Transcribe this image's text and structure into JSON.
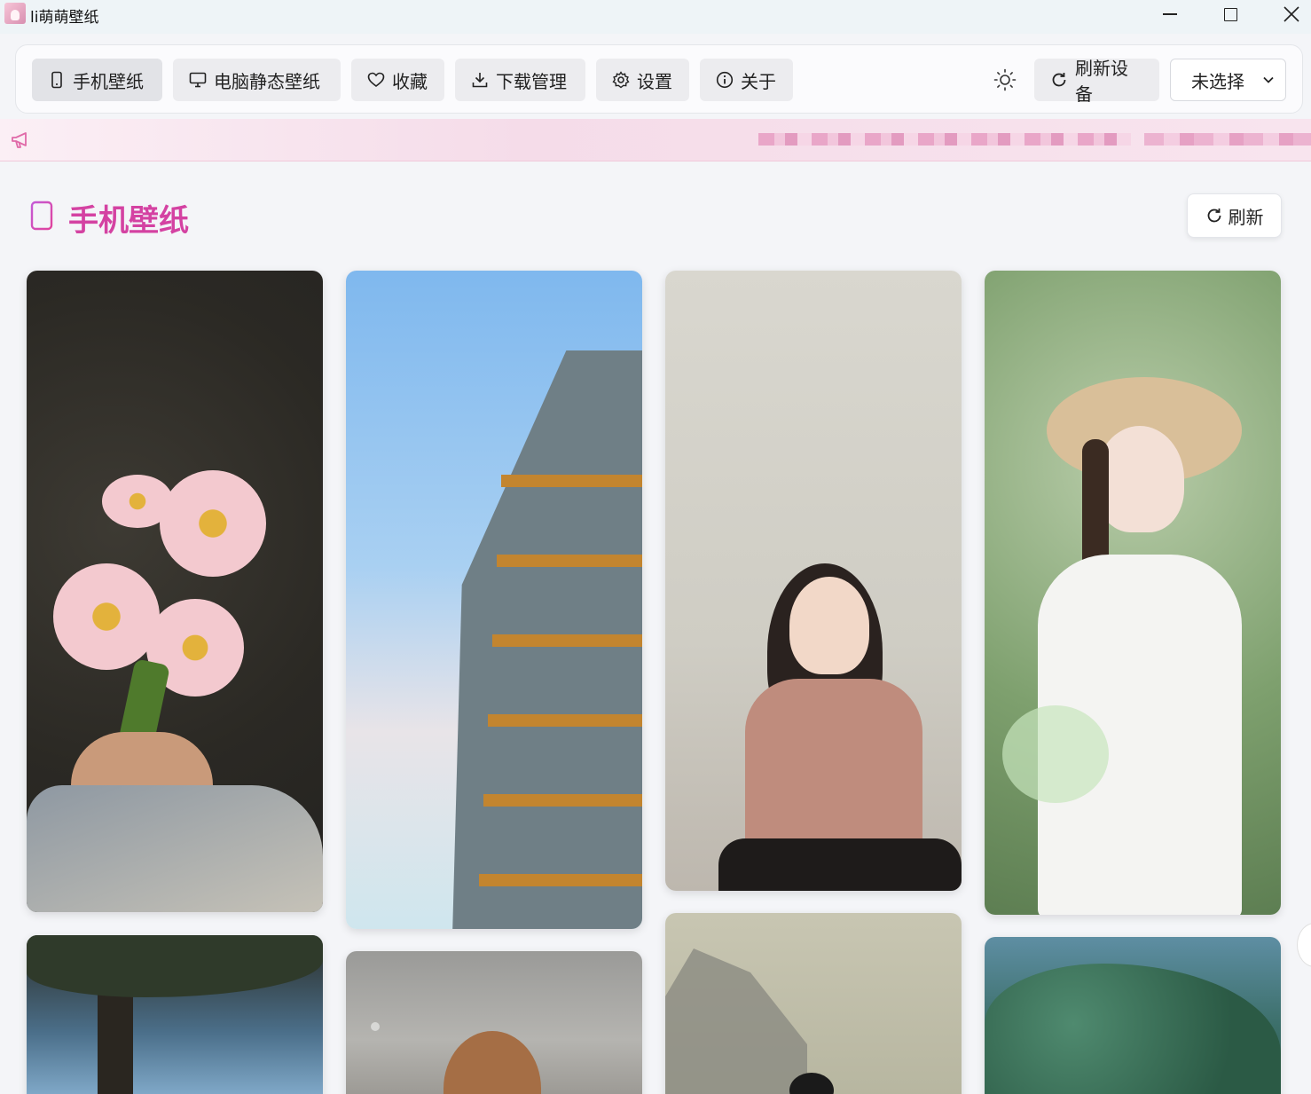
{
  "window": {
    "title": "li萌萌壁纸"
  },
  "nav": {
    "tabs": [
      {
        "label": "手机壁纸",
        "icon": "phone-icon",
        "active": true
      },
      {
        "label": "电脑静态壁纸",
        "icon": "monitor-icon",
        "active": false
      },
      {
        "label": "收藏",
        "icon": "heart-icon",
        "active": false
      },
      {
        "label": "下载管理",
        "icon": "download-icon",
        "active": false
      },
      {
        "label": "设置",
        "icon": "gear-icon",
        "active": false
      },
      {
        "label": "关于",
        "icon": "info-icon",
        "active": false
      }
    ],
    "theme_icon": "sun-icon",
    "refresh_devices_label": "刷新设备",
    "device_select_value": "未选择"
  },
  "announcement": {
    "icon": "megaphone-icon"
  },
  "section": {
    "title": "手机壁纸",
    "icon": "phone-icon",
    "refresh_label": "刷新"
  },
  "colors": {
    "accent": "#d442a2",
    "accent_light": "#e9a6c8",
    "background": "#f4f5f8"
  },
  "wallpapers": [
    {
      "subject": "pink gerbera daisies"
    },
    {
      "subject": "building against sky"
    },
    {
      "subject": "girl in pink t-shirt"
    },
    {
      "subject": "girl in straw hat"
    },
    {
      "subject": "pine tree"
    },
    {
      "subject": "girl by concrete wall"
    },
    {
      "subject": "ink painting"
    },
    {
      "subject": "forest"
    }
  ]
}
